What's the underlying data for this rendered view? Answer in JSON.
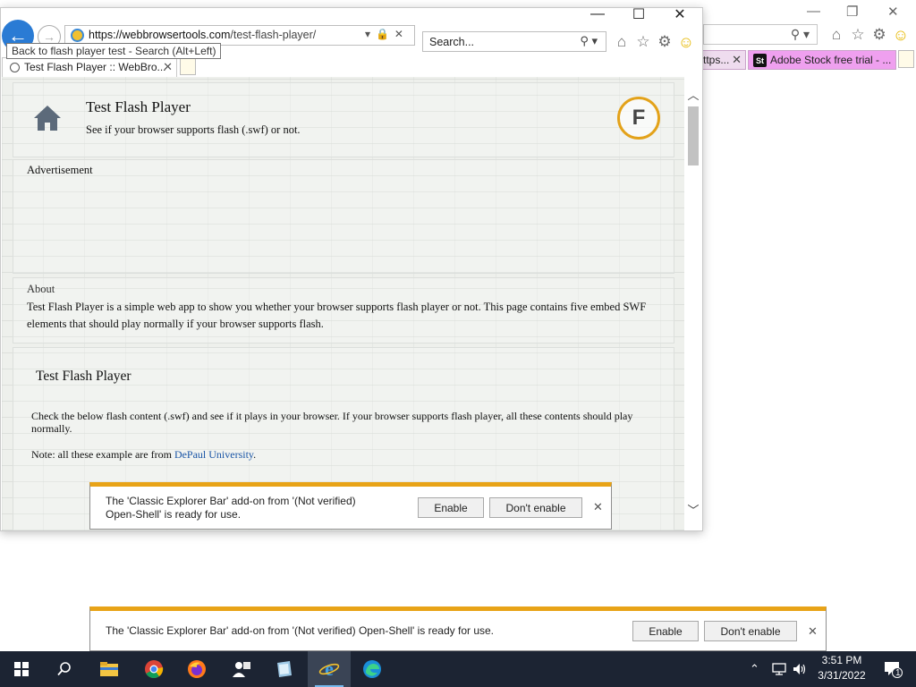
{
  "background_window": {
    "tabs": [
      {
        "label": "ttps..."
      },
      {
        "label": "Adobe Stock free trial - ..."
      }
    ],
    "tab_badge": "St"
  },
  "browser": {
    "address_host": "https://webbrowsertools.com",
    "address_path": "/test-flash-player/",
    "search_placeholder": "Search...",
    "tooltip": "Back to flash player test - Search (Alt+Left)",
    "active_tab": "Test Flash Player :: WebBro..."
  },
  "page": {
    "title": "Test Flash Player",
    "subtitle": "See if your browser supports flash (.swf) or not.",
    "logo_letter": "F",
    "advertisement_label": "Advertisement",
    "about_label": "About",
    "about_text": "Test Flash Player is a simple web app to show you whether your browser supports flash player or not. This page contains five embed SWF elements that should play normally if your browser supports flash.",
    "section_title": "Test Flash Player",
    "section_text": "Check the below flash content (.swf) and see if it plays in your browser. If your browser supports flash player, all these contents should play normally.",
    "note_prefix": "Note: all these example are from ",
    "note_link": "DePaul University",
    "note_suffix": "."
  },
  "notification_inner": {
    "message_line1": "The 'Classic Explorer Bar' add-on from '(Not verified)",
    "message_line2": "Open-Shell' is ready for use.",
    "enable_label": "Enable",
    "dont_enable_label": "Don't enable"
  },
  "notification_outer": {
    "message": "The 'Classic Explorer Bar' add-on from '(Not verified) Open-Shell' is ready for use.",
    "enable_label": "Enable",
    "dont_enable_label": "Don't enable"
  },
  "taskbar": {
    "time": "3:51 PM",
    "date": "3/31/2022",
    "notification_count": "1",
    "pinned": [
      "windows-start",
      "search",
      "file-explorer",
      "chrome",
      "firefox",
      "people",
      "app",
      "internet-explorer",
      "edge"
    ]
  },
  "colors": {
    "notification_accent": "#e8a317",
    "logo_ring": "#e3a21a",
    "link": "#1a55a6",
    "taskbar": "#1c2433",
    "back_button": "#2a7bd4"
  }
}
